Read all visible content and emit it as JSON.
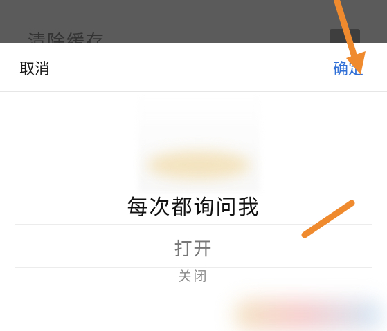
{
  "backdrop": {
    "text": "清除缓存"
  },
  "toolbar": {
    "cancel_label": "取消",
    "confirm_label": "确定",
    "confirm_color": "#2f6fd6"
  },
  "picker": {
    "options": [
      {
        "label": "每次都询问我",
        "selected": true
      },
      {
        "label": "打开",
        "selected": false
      },
      {
        "label": "关闭",
        "selected": false
      }
    ]
  },
  "annotations": {
    "arrow_color": "#f08a2e",
    "arrow_icons": [
      "arrow-to-confirm-icon",
      "arrow-to-option-icon"
    ]
  }
}
